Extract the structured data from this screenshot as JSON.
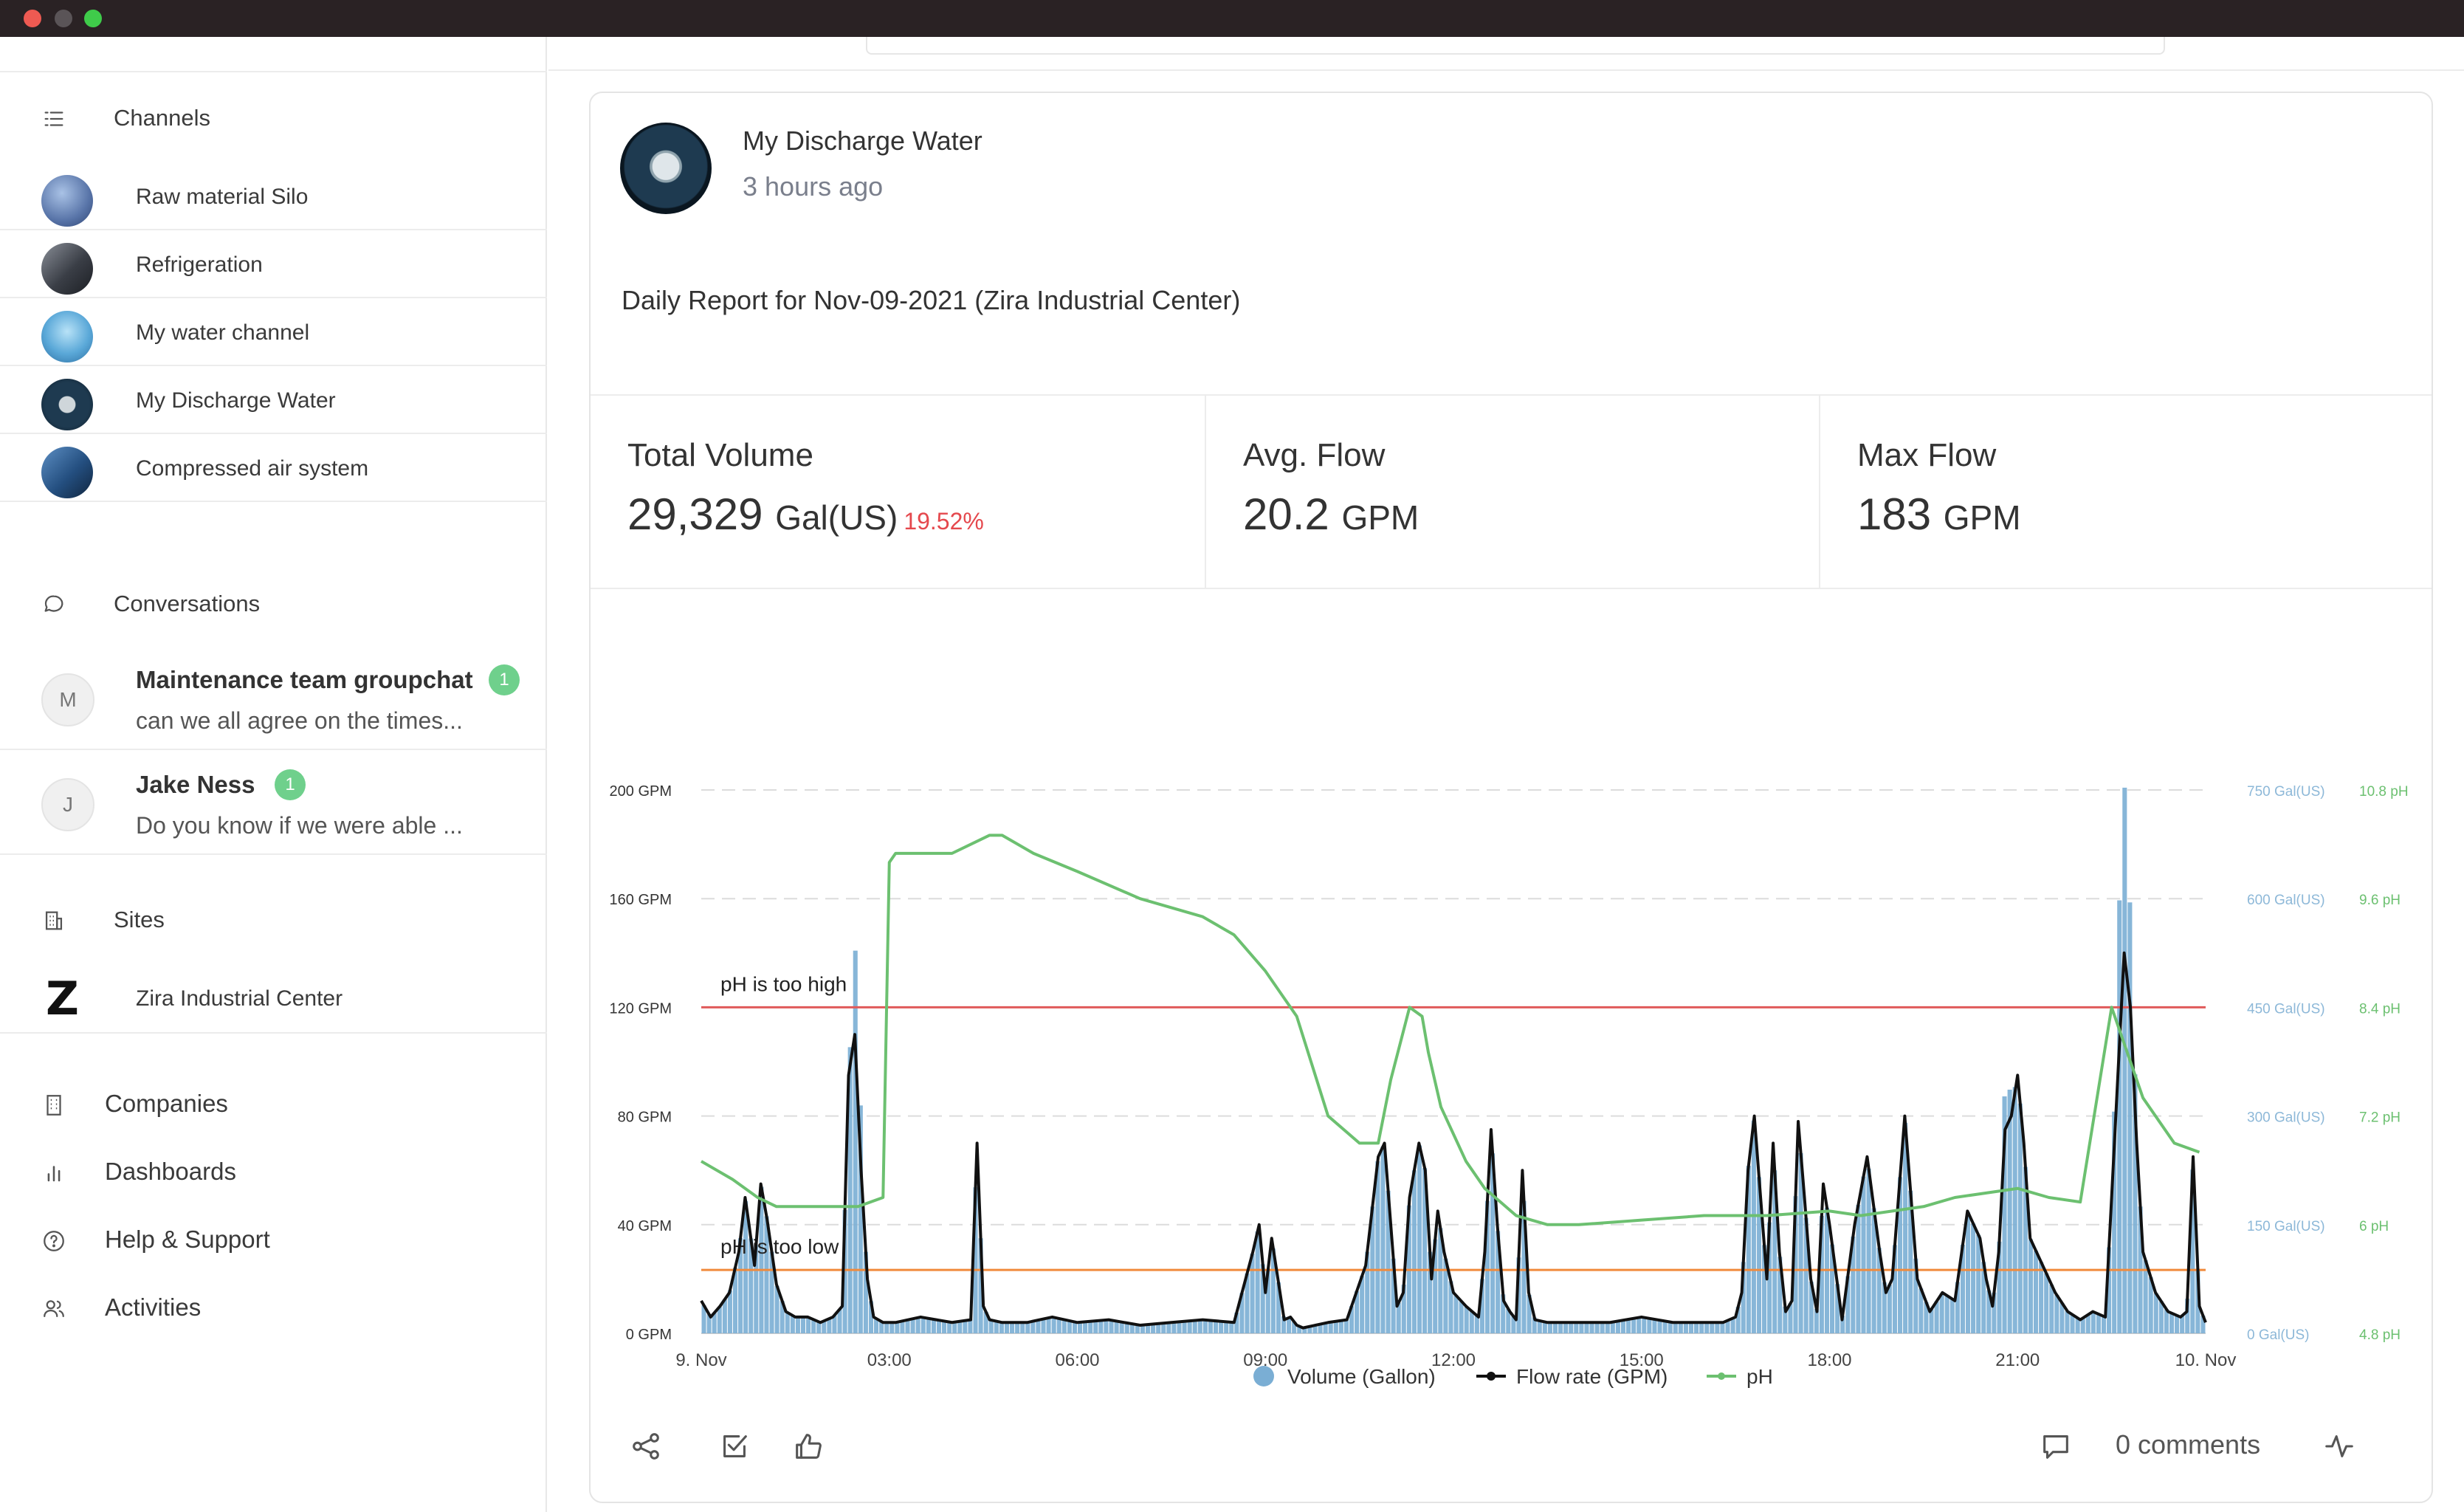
{
  "sidebar": {
    "channels_header": "Channels",
    "channels": [
      {
        "label": "Raw material Silo",
        "thumb_color": "#6a86b8"
      },
      {
        "label": "Refrigeration",
        "thumb_color": "#4b4f58"
      },
      {
        "label": "My water channel",
        "thumb_color": "#5fa9d9"
      },
      {
        "label": "My Discharge Water",
        "thumb_color": "#1e3a50"
      },
      {
        "label": "Compressed air system",
        "thumb_color": "#2c5f8f"
      }
    ],
    "conversations_header": "Conversations",
    "conversations": [
      {
        "initial": "M",
        "name": "Maintenance team groupchat",
        "badge": "1",
        "preview": "can we all agree on the times..."
      },
      {
        "initial": "J",
        "name": "Jake Ness",
        "badge": "1",
        "preview": "Do you know if we were able ..."
      }
    ],
    "sites_header": "Sites",
    "sites": [
      {
        "label": "Zira Industrial Center",
        "logo": "Z"
      }
    ],
    "nav": [
      {
        "label": "Companies",
        "icon": "building-icon"
      },
      {
        "label": "Dashboards",
        "icon": "bar-chart-icon"
      },
      {
        "label": "Help & Support",
        "icon": "help-icon"
      },
      {
        "label": "Activities",
        "icon": "users-icon"
      }
    ]
  },
  "post": {
    "title": "My Discharge Water",
    "time": "3 hours ago",
    "report": "Daily Report for Nov-09-2021 (Zira Industrial Center)",
    "stats": [
      {
        "title": "Total Volume",
        "value": "29,329",
        "unit": "Gal(US)",
        "change": "19.52%"
      },
      {
        "title": "Avg. Flow",
        "value": "20.2",
        "unit": "GPM",
        "change": ""
      },
      {
        "title": "Max Flow",
        "value": "183",
        "unit": "GPM",
        "change": ""
      }
    ],
    "comments": "0 comments"
  },
  "colors": {
    "volume": "#7aaed4",
    "flow": "#111111",
    "ph": "#6cc070",
    "high_line": "#e05a5a",
    "low_line": "#f08a3c",
    "right_axis_volume": "#8db8d8",
    "right_axis_ph": "#6cc070"
  },
  "chart_data": {
    "type": "line",
    "x_ticks": [
      "9. Nov",
      "03:00",
      "06:00",
      "09:00",
      "12:00",
      "15:00",
      "18:00",
      "21:00",
      "10. Nov"
    ],
    "y_left_ticks": [
      "0 GPM",
      "40 GPM",
      "80 GPM",
      "120 GPM",
      "160 GPM",
      "200 GPM"
    ],
    "y_right_volume_ticks": [
      "0 Gal(US)",
      "150 Gal(US)",
      "300 Gal(US)",
      "450 Gal(US)",
      "600 Gal(US)",
      "750 Gal(US)"
    ],
    "y_right_ph_ticks": [
      "4.8 pH",
      "6 pH",
      "7.2 pH",
      "8.4 pH",
      "9.6 pH",
      "10.8 pH"
    ],
    "ylim_flow": [
      0,
      200
    ],
    "ylim_volume": [
      0,
      750
    ],
    "ylim_ph": [
      4.8,
      10.8
    ],
    "xlim_hours": [
      0,
      24
    ],
    "annotations": [
      {
        "label": "pH is too high",
        "ph": 8.4,
        "color": "#e05a5a"
      },
      {
        "label": "pH is too low",
        "ph": 5.5,
        "color": "#f08a3c"
      }
    ],
    "legend": [
      "Volume (Gallon)",
      "Flow rate (GPM)",
      "pH"
    ],
    "series": [
      {
        "name": "Flow rate (GPM)",
        "x": [
          0,
          0.15,
          0.3,
          0.45,
          0.6,
          0.7,
          0.75,
          0.85,
          0.95,
          1.05,
          1.2,
          1.35,
          1.5,
          1.7,
          1.9,
          2.1,
          2.25,
          2.35,
          2.45,
          2.55,
          2.65,
          2.75,
          2.9,
          3.1,
          3.5,
          4,
          4.3,
          4.4,
          4.5,
          4.6,
          4.8,
          5.2,
          5.6,
          6,
          6.5,
          7,
          7.5,
          8,
          8.5,
          8.8,
          8.9,
          9.0,
          9.1,
          9.2,
          9.3,
          9.4,
          9.5,
          9.6,
          9.8,
          10,
          10.3,
          10.6,
          10.8,
          10.9,
          11.0,
          11.1,
          11.2,
          11.3,
          11.45,
          11.55,
          11.65,
          11.75,
          11.85,
          12,
          12.2,
          12.4,
          12.5,
          12.6,
          12.7,
          12.8,
          12.9,
          13.0,
          13.1,
          13.2,
          13.3,
          13.5,
          14,
          14.5,
          15,
          15.5,
          16,
          16.3,
          16.5,
          16.6,
          16.7,
          16.8,
          16.9,
          17.0,
          17.1,
          17.2,
          17.3,
          17.4,
          17.5,
          17.6,
          17.7,
          17.8,
          17.9,
          18.0,
          18.2,
          18.4,
          18.6,
          18.8,
          18.9,
          19.0,
          19.1,
          19.2,
          19.4,
          19.6,
          19.8,
          20.0,
          20.2,
          20.4,
          20.5,
          20.6,
          20.7,
          20.8,
          20.9,
          21.0,
          21.1,
          21.2,
          21.4,
          21.6,
          21.8,
          22.0,
          22.2,
          22.4,
          22.5,
          22.6,
          22.7,
          22.8,
          22.9,
          23.0,
          23.2,
          23.4,
          23.6,
          23.7,
          23.8,
          23.9,
          24
        ],
        "values": [
          12,
          6,
          10,
          15,
          30,
          50,
          42,
          25,
          55,
          42,
          18,
          8,
          6,
          6,
          4,
          6,
          10,
          95,
          110,
          60,
          20,
          6,
          4,
          4,
          6,
          4,
          5,
          70,
          10,
          5,
          4,
          4,
          6,
          4,
          5,
          3,
          4,
          5,
          4,
          30,
          40,
          15,
          35,
          20,
          5,
          6,
          3,
          2,
          3,
          4,
          5,
          25,
          65,
          70,
          40,
          10,
          15,
          50,
          70,
          60,
          20,
          45,
          30,
          15,
          10,
          6,
          30,
          75,
          40,
          12,
          8,
          5,
          60,
          15,
          5,
          4,
          4,
          4,
          6,
          4,
          4,
          4,
          6,
          15,
          60,
          80,
          50,
          20,
          70,
          30,
          8,
          12,
          78,
          50,
          20,
          8,
          55,
          40,
          5,
          40,
          65,
          30,
          15,
          20,
          50,
          80,
          20,
          8,
          15,
          12,
          45,
          35,
          20,
          10,
          30,
          75,
          80,
          95,
          70,
          35,
          25,
          15,
          8,
          5,
          8,
          6,
          50,
          95,
          140,
          120,
          70,
          30,
          15,
          8,
          6,
          8,
          65,
          10,
          4
        ],
        "axis": "flow"
      },
      {
        "name": "pH",
        "x": [
          0,
          0.5,
          0.9,
          1.2,
          1.8,
          2.5,
          2.9,
          3.0,
          3.1,
          4.0,
          4.6,
          4.8,
          5.3,
          6.0,
          7.0,
          8.0,
          8.5,
          9.0,
          9.5,
          10.0,
          10.5,
          10.8,
          11.0,
          11.3,
          11.5,
          11.6,
          11.8,
          12.0,
          12.2,
          12.5,
          13.0,
          13.5,
          14.0,
          15.0,
          16.0,
          17.0,
          18.0,
          18.5,
          19.0,
          19.5,
          20.0,
          20.5,
          21.0,
          21.5,
          22.0,
          22.5,
          23.0,
          23.5,
          23.9
        ],
        "values": [
          6.7,
          6.5,
          6.3,
          6.2,
          6.2,
          6.2,
          6.3,
          10.0,
          10.1,
          10.1,
          10.3,
          10.3,
          10.1,
          9.9,
          9.6,
          9.4,
          9.2,
          8.8,
          8.3,
          7.2,
          6.9,
          6.9,
          7.6,
          8.4,
          8.3,
          7.9,
          7.3,
          7.0,
          6.7,
          6.4,
          6.1,
          6.0,
          6.0,
          6.05,
          6.1,
          6.1,
          6.15,
          6.1,
          6.15,
          6.2,
          6.3,
          6.35,
          6.4,
          6.3,
          6.25,
          8.4,
          7.4,
          6.9,
          6.8
        ],
        "axis": "ph"
      },
      {
        "name": "Volume (Gallon)",
        "x": [
          0,
          1.05,
          1.2,
          2.35,
          2.45,
          4.4,
          8.9,
          9.2,
          10.8,
          11.3,
          11.55,
          12.5,
          13.0,
          16.6,
          16.8,
          17.2,
          17.5,
          18.0,
          19.0,
          20.4,
          20.6,
          20.7,
          20.8,
          21.1,
          22.3,
          22.5,
          22.6,
          22.7,
          23.0,
          23.6,
          23.9
        ],
        "values": [
          40,
          230,
          350,
          440,
          600,
          350,
          150,
          170,
          270,
          320,
          240,
          280,
          270,
          350,
          300,
          370,
          340,
          330,
          300,
          250,
          550,
          450,
          560,
          370,
          270,
          430,
          680,
          660,
          420,
          330,
          60
        ],
        "axis": "volume"
      }
    ]
  }
}
